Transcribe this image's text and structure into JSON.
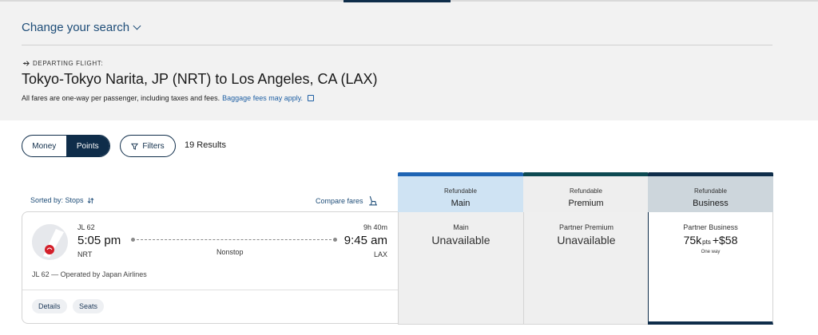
{
  "search": {
    "change_label": "Change your search"
  },
  "flight_header": {
    "departing_label": "DEPARTING FLIGHT:",
    "route_title": "Tokyo-Tokyo Narita, JP (NRT) to Los Angeles, CA (LAX)",
    "fare_note": "All fares are one-way per passenger, including taxes and fees.",
    "baggage_link": "Baggage fees may apply."
  },
  "controls": {
    "money_label": "Money",
    "points_label": "Points",
    "filters_label": "Filters",
    "results_count": "19 Results",
    "selected_mode": "Points"
  },
  "list": {
    "sorted_label": "Sorted by: Stops",
    "compare_label": "Compare fares"
  },
  "flight": {
    "flight_number": "JL 62",
    "depart_time": "5:05 pm",
    "arrive_time": "9:45 am",
    "duration": "9h 40m",
    "origin": "NRT",
    "destination": "LAX",
    "stops": "Nonstop",
    "operated_by": "JL 62 — Operated by Japan Airlines",
    "details_label": "Details",
    "seats_label": "Seats"
  },
  "fares": [
    {
      "refund": "Refundable",
      "cabin": "Main",
      "sub": "Main",
      "value": "Unavailable",
      "accent": "#1e64b4"
    },
    {
      "refund": "Refundable",
      "cabin": "Premium",
      "sub": "Partner Premium",
      "value": "Unavailable",
      "accent": "#0d4a52"
    },
    {
      "refund": "Refundable",
      "cabin": "Business",
      "sub": "Partner Business",
      "points": "75k",
      "points_unit": "pts",
      "cash": "+$58",
      "note": "One way",
      "accent": "#0f2d4a"
    }
  ],
  "colors": {
    "brand_navy": "#0f2d4a",
    "link_blue": "#1e5fa3",
    "main_header_bg": "#cfe3f3",
    "premium_header_bg": "#eeeeee",
    "business_header_bg": "#cdd6dc"
  }
}
